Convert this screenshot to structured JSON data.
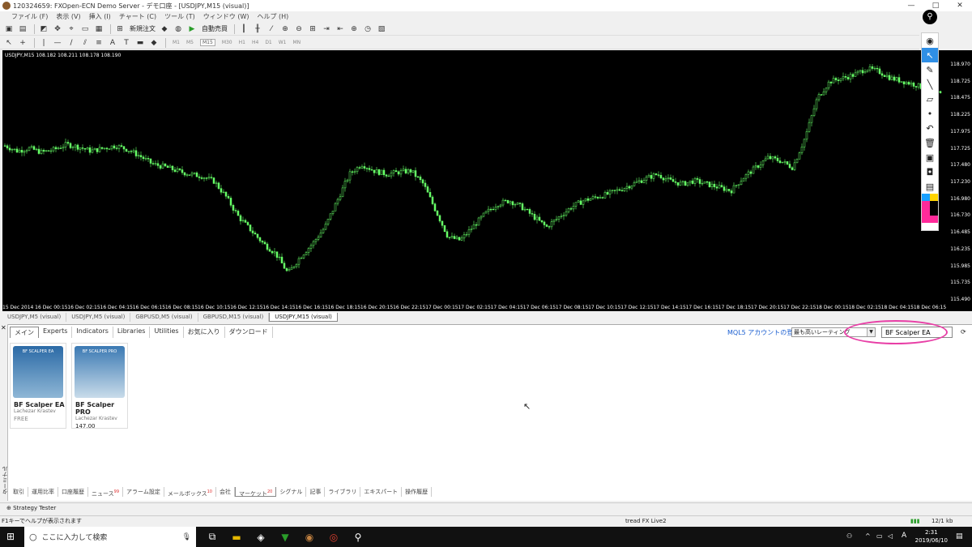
{
  "window": {
    "title": "120324659: FXOpen-ECN Demo Server - デモ口座 - [USDJPY,M15 (visual)]",
    "minimize": "—",
    "maximize": "□",
    "close": "✕"
  },
  "menu": [
    "ファイル (F)",
    "表示 (V)",
    "挿入 (I)",
    "チャート (C)",
    "ツール (T)",
    "ウィンドウ (W)",
    "ヘルプ (H)"
  ],
  "toolbar": {
    "new_order": "新規注文",
    "auto_trade": "自動売買",
    "tool_letter": "A",
    "periods": [
      "M1",
      "M5",
      "M15",
      "M30",
      "H1",
      "H4",
      "D1",
      "W1",
      "MN"
    ],
    "active_period": "M15"
  },
  "chart": {
    "info": "USDJPY,M15  108.182 108.211 108.178 108.190",
    "y_ticks": [
      "118.970",
      "118.725",
      "118.475",
      "118.225",
      "117.975",
      "117.725",
      "117.480",
      "117.230",
      "116.980",
      "116.730",
      "116.485",
      "116.235",
      "115.985",
      "115.735",
      "115.490"
    ],
    "x_ticks": [
      "15 Dec 2014",
      "16 Dec 00:15",
      "16 Dec 02:15",
      "16 Dec 04:15",
      "16 Dec 06:15",
      "16 Dec 08:15",
      "16 Dec 10:15",
      "16 Dec 12:15",
      "16 Dec 14:15",
      "16 Dec 16:15",
      "16 Dec 18:15",
      "16 Dec 20:15",
      "16 Dec 22:15",
      "17 Dec 00:15",
      "17 Dec 02:15",
      "17 Dec 04:15",
      "17 Dec 06:15",
      "17 Dec 08:15",
      "17 Dec 10:15",
      "17 Dec 12:15",
      "17 Dec 14:15",
      "17 Dec 16:15",
      "17 Dec 18:15",
      "17 Dec 20:15",
      "17 Dec 22:15",
      "18 Dec 00:15",
      "18 Dec 02:15",
      "18 Dec 04:15",
      "18 Dec 06:15"
    ],
    "candle_color": "#66ff66",
    "background": "#000000",
    "price_path": [
      117.78,
      117.7,
      117.74,
      117.68,
      117.72,
      117.8,
      117.76,
      117.7,
      117.74,
      117.78,
      117.72,
      117.62,
      117.5,
      117.46,
      117.4,
      117.35,
      117.32,
      117.24,
      117.0,
      116.7,
      116.5,
      116.3,
      116.15,
      115.85,
      116.1,
      116.3,
      116.55,
      116.95,
      117.35,
      117.5,
      117.4,
      117.35,
      117.38,
      117.4,
      117.2,
      116.8,
      116.4,
      116.35,
      116.55,
      116.75,
      116.9,
      116.95,
      116.85,
      116.7,
      116.55,
      116.7,
      116.85,
      116.95,
      117.0,
      117.05,
      117.12,
      117.2,
      117.28,
      117.35,
      117.25,
      117.2,
      117.25,
      117.2,
      117.15,
      117.1,
      117.3,
      117.45,
      117.6,
      117.55,
      117.45,
      117.9,
      118.5,
      118.75,
      118.8,
      118.85,
      118.95,
      118.9,
      118.8,
      118.75,
      118.7,
      118.62,
      118.55
    ]
  },
  "chart_tabs": [
    "USDJPY,M5 (visual)",
    "USDJPY,M5 (visual)",
    "GBPUSD,M5 (visual)",
    "GBPUSD,M15 (visual)",
    "USDJPY,M15 (visual)"
  ],
  "active_chart_tab": 4,
  "market": {
    "tabs": [
      "メイン",
      "Experts",
      "Indicators",
      "Libraries",
      "Utilities",
      "お気に入り",
      "ダウンロード"
    ],
    "account_link": "MQL5 アカウントの登↓",
    "sort_value": "最も高いレーティング",
    "search_value": "BF Scalper EA",
    "highlight_color": "#e83ea6",
    "products": [
      {
        "name": "BF Scalper EA",
        "author": "Lachezar Krastev",
        "price": "FREE",
        "thumb_label": "BF SCALPER EA"
      },
      {
        "name": "BF Scalper PRO",
        "author": "Lachezar Krastev",
        "price": "147.00",
        "thumb_label": "BF SCALPER PRO"
      }
    ],
    "side_label": "ターミナル"
  },
  "bottom_tabs": [
    {
      "label": "取引",
      "badge": ""
    },
    {
      "label": "運用比率",
      "badge": ""
    },
    {
      "label": "口座履歴",
      "badge": ""
    },
    {
      "label": "ニュース",
      "badge": "99"
    },
    {
      "label": "アラーム設定",
      "badge": ""
    },
    {
      "label": "メールボックス",
      "badge": "10"
    },
    {
      "label": "会社",
      "badge": ""
    },
    {
      "label": "マーケット",
      "badge": "20"
    },
    {
      "label": "シグナル",
      "badge": ""
    },
    {
      "label": "記事",
      "badge": ""
    },
    {
      "label": "ライブラリ",
      "badge": ""
    },
    {
      "label": "エキスパート",
      "badge": ""
    },
    {
      "label": "操作履歴",
      "badge": ""
    }
  ],
  "active_bottom_tab": 7,
  "strategy_tester": "Strategy Tester",
  "status": {
    "help": "F1キーでヘルプが表示されます",
    "profile": "tread FX Live2",
    "traffic": "12/1 kb"
  },
  "taskbar": {
    "search_placeholder": "ここに入力して検索",
    "time": "2:31",
    "date": "2019/06/10",
    "ime": "A"
  }
}
